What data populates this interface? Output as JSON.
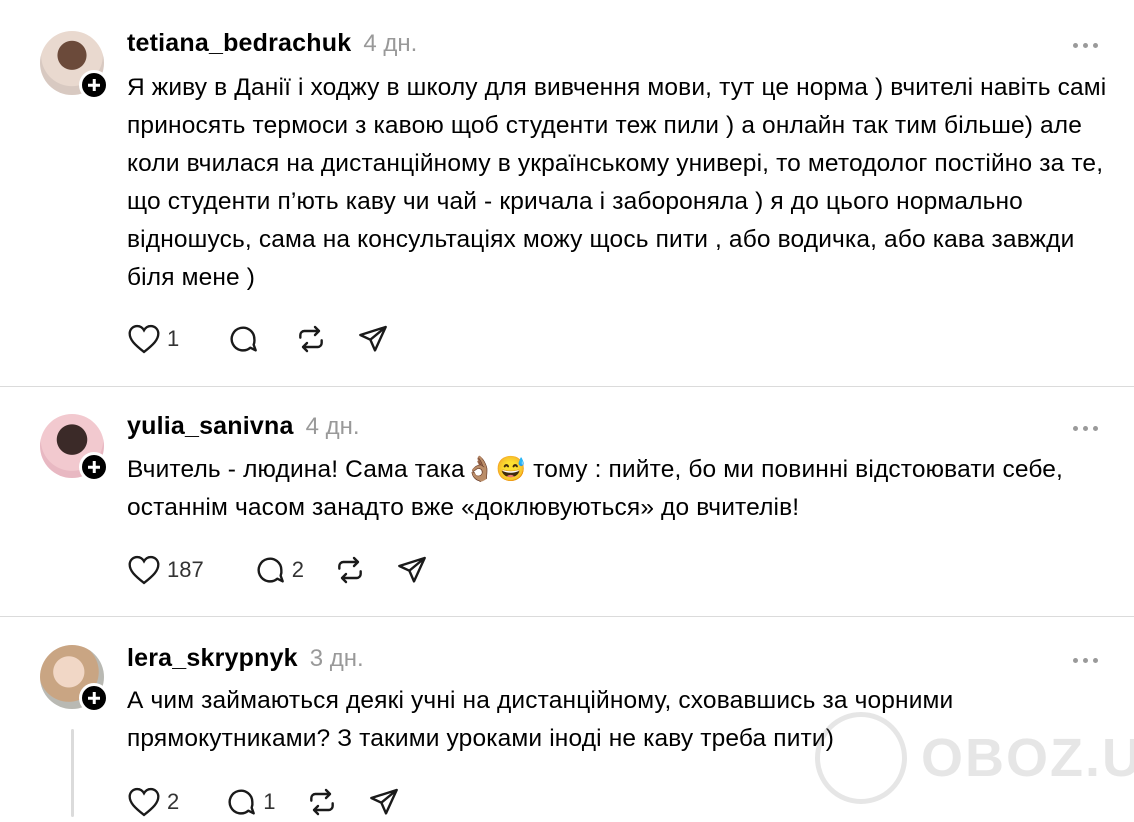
{
  "posts": [
    {
      "username": "tetiana_bedrachuk",
      "time": "4 дн.",
      "text": "Я живу в Данії і ходжу в школу для вивчення мови, тут це норма ) вчителі навіть самі приносять термоси з кавою щоб студенти теж пили ) а онлайн так тим більше) але коли вчилася на дистанційному в українському универі, то методолог постійно за те, що студенти п’ють каву чи чай - кричала і забороняла ) я до цього нормально відношусь, сама на консультаціях можу щось пити , або водичка, або кава завжди біля мене )",
      "likes": "1",
      "replies": ""
    },
    {
      "username": "yulia_sanivna",
      "time": "4 дн.",
      "text": "Вчитель - людина! Сама така👌🏽😅 тому : пийте, бо ми повинні відстоювати себе, останнім часом занадто вже «доклювуються» до вчителів!",
      "likes": "187",
      "replies": "2"
    },
    {
      "username": "lera_skrypnyk",
      "time": "3 дн.",
      "text": "А чим займаються деякі учні на дистанційному, сховавшись за чорними прямокутниками? З такими уроками іноді не каву треба пити)",
      "likes": "2",
      "replies": "1"
    }
  ],
  "watermark": "OBOZ.UA",
  "colors": {
    "muted": "#999999",
    "divider": "#dbdbdb",
    "icon": "#1a1a1a"
  },
  "icons": [
    "heart-icon",
    "comment-icon",
    "repost-icon",
    "share-icon",
    "more-icon",
    "follow-plus-icon"
  ]
}
